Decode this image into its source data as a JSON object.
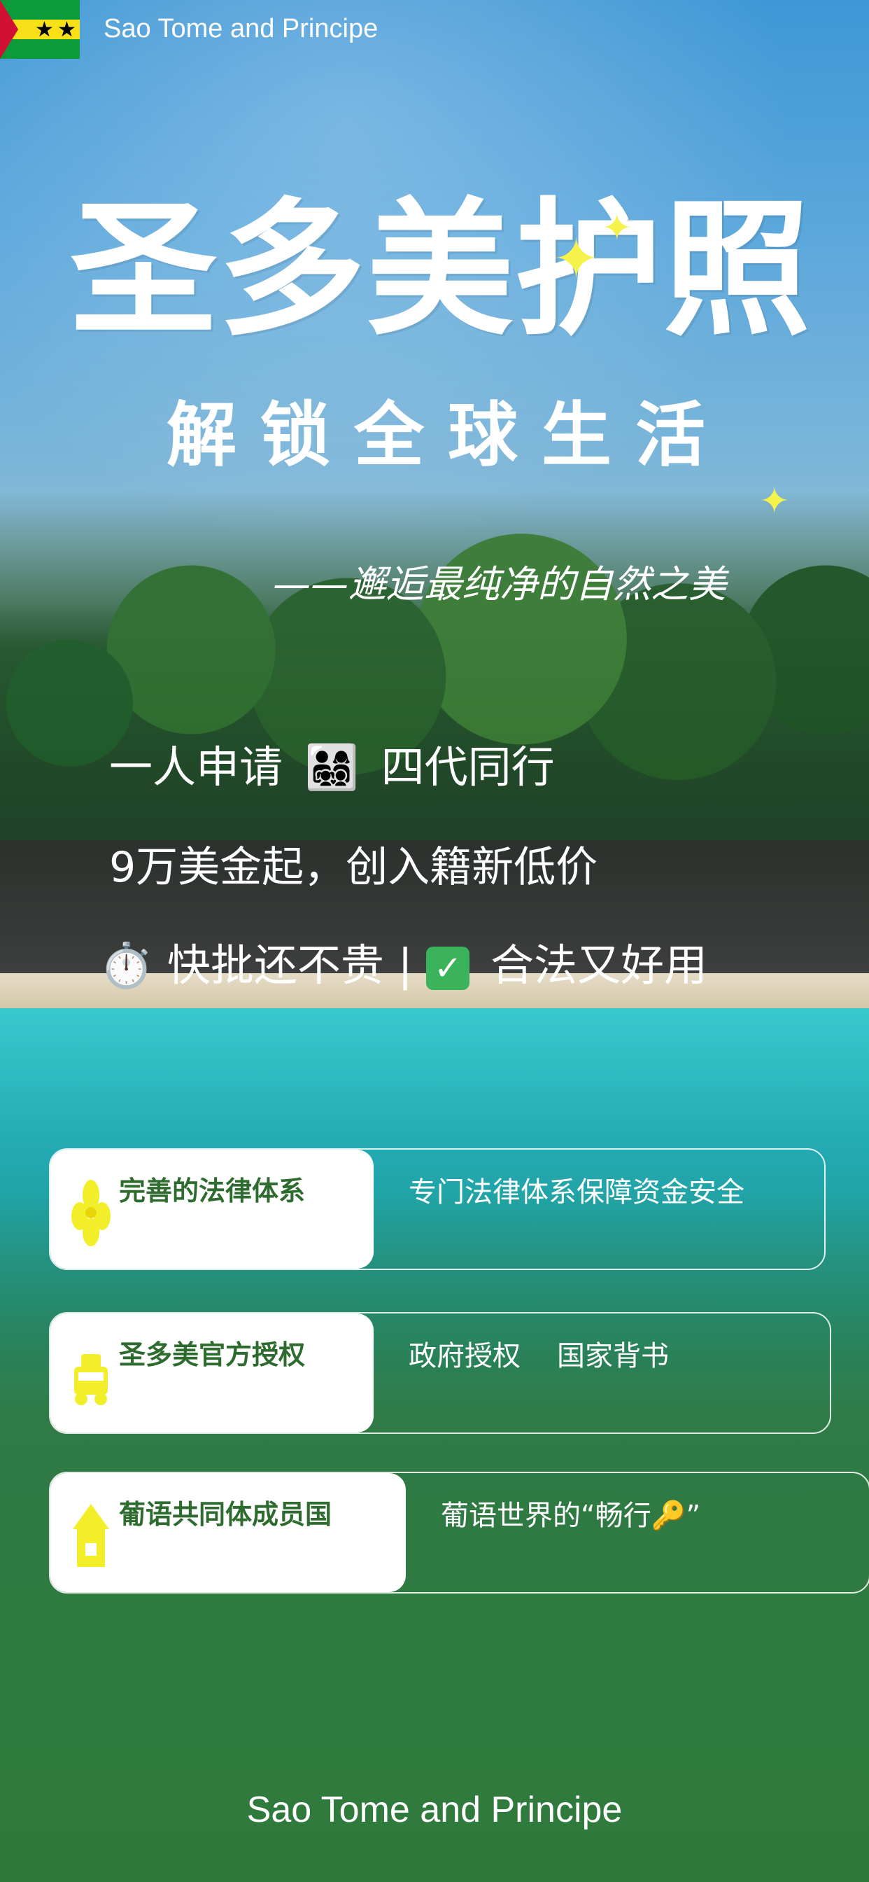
{
  "header": {
    "country": "Sao Tome and Principe"
  },
  "hero": {
    "title": "圣多美护照",
    "subtitle": "解锁全球生活",
    "tagline": "——邂逅最纯净的自然之美"
  },
  "highlights": {
    "line1_a": "一人申请",
    "line1_emoji": "👨‍👩‍👧‍👦",
    "line1_b": "四代同行",
    "line2": "9万美金起，创入籍新低价",
    "line3_a": "⏱️ 快批还不贵 |",
    "line3_b": "合法又好用",
    "check_icon": "✓"
  },
  "cards": [
    {
      "title": "完善的法律体系",
      "desc": "专门法律体系保障资金安全",
      "icon": "flower-icon"
    },
    {
      "title": "圣多美官方授权",
      "desc": [
        "政府授权",
        "国家背书"
      ],
      "icon": "car-icon"
    },
    {
      "title": "葡语共同体成员国",
      "desc": "葡语世界的“畅行🔑”",
      "icon": "house-icon"
    }
  ],
  "footer": "Sao Tome and Principe",
  "colors": {
    "sparkle": "#f5f24b",
    "card_title": "#2e6b2e",
    "icon_yellow": "#f2ef2a",
    "flag_green": "#0b9b3a",
    "flag_yellow": "#f7e018",
    "flag_red": "#d21034"
  }
}
